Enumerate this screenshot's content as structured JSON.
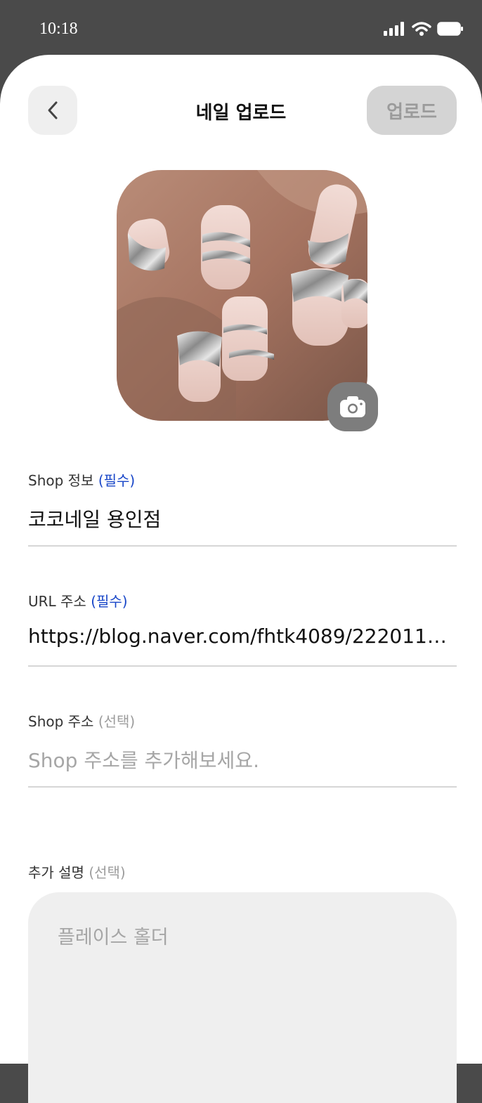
{
  "status_bar": {
    "time": "10:18"
  },
  "header": {
    "title": "네일 업로드",
    "upload_label": "업로드"
  },
  "fields": {
    "shop_info": {
      "label": "Shop 정보",
      "tag": "(필수)",
      "value": "코코네일 용인점"
    },
    "url": {
      "label": "URL 주소",
      "tag": "(필수)",
      "value": "https://blog.naver.com/fhtk4089/2220118…"
    },
    "shop_address": {
      "label": "Shop 주소",
      "tag": "(선택)",
      "placeholder": "Shop 주소를 추가해보세요."
    },
    "description": {
      "label": "추가 설명",
      "tag": "(선택)",
      "placeholder": "플레이스 홀더"
    }
  },
  "colors": {
    "required": "#1846c8",
    "optional": "#9c9c9c",
    "disabled_button": "#d4d4d4"
  },
  "icons": [
    "back-chevron-icon",
    "camera-icon",
    "signal-icon",
    "wifi-icon",
    "battery-icon"
  ]
}
